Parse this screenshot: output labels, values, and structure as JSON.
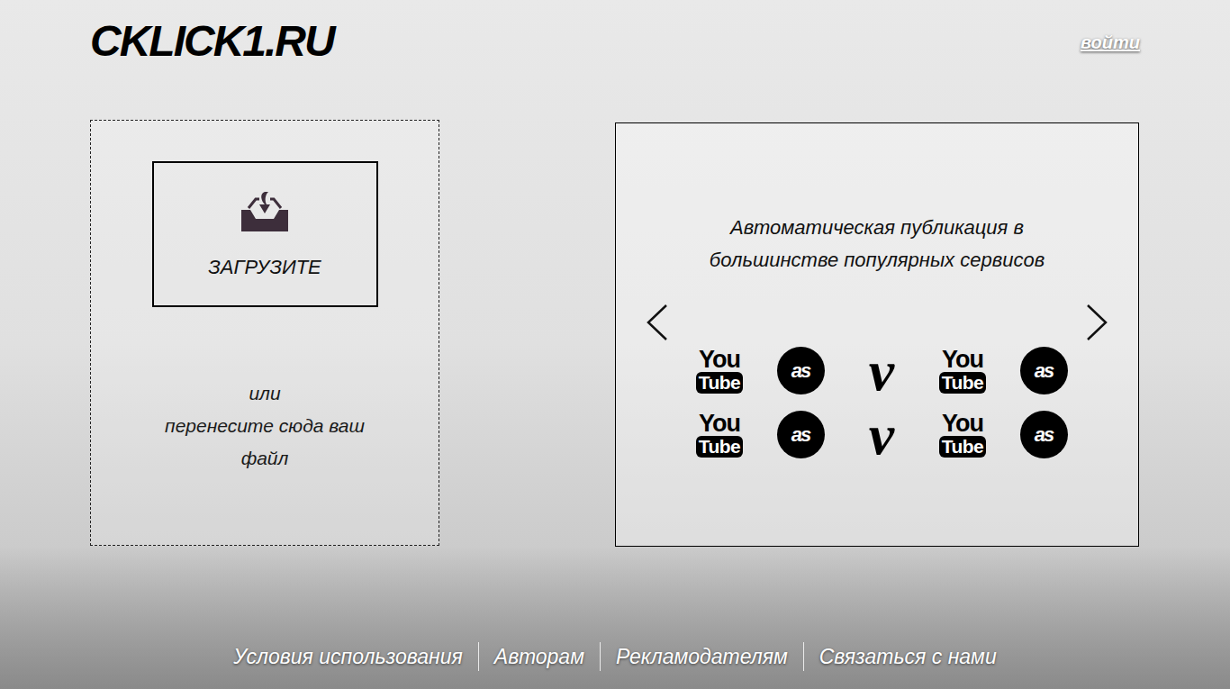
{
  "logo": "CKLICK1.RU",
  "login": "войти",
  "upload": {
    "button": "ЗАГРУЗИТЕ",
    "hint": [
      "или",
      "перенесите сюда ваш",
      "файл"
    ]
  },
  "promo": {
    "title": [
      "Автоматическая публикация в",
      "большинстве популярных сервисов"
    ],
    "services": [
      {
        "kind": "youtube",
        "mark": "You",
        "sub": "Tube"
      },
      {
        "kind": "lastfm",
        "mark": "as"
      },
      {
        "kind": "vimeo",
        "mark": "v"
      },
      {
        "kind": "youtube",
        "mark": "You",
        "sub": "Tube"
      },
      {
        "kind": "lastfm",
        "mark": "as"
      },
      {
        "kind": "youtube",
        "mark": "You",
        "sub": "Tube"
      },
      {
        "kind": "lastfm",
        "mark": "as"
      },
      {
        "kind": "vimeo",
        "mark": "v"
      },
      {
        "kind": "youtube",
        "mark": "You",
        "sub": "Tube"
      },
      {
        "kind": "lastfm",
        "mark": "as"
      }
    ]
  },
  "footer": [
    "Условия использования",
    "Авторам",
    "Рекламодателям",
    "Связаться с нами"
  ]
}
